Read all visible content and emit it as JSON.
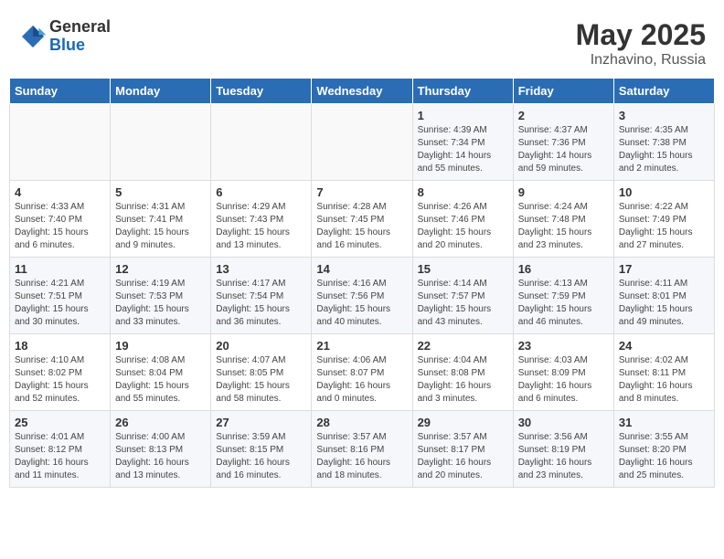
{
  "logo": {
    "general": "General",
    "blue": "Blue"
  },
  "title": "May 2025",
  "location": "Inzhavino, Russia",
  "days_of_week": [
    "Sunday",
    "Monday",
    "Tuesday",
    "Wednesday",
    "Thursday",
    "Friday",
    "Saturday"
  ],
  "weeks": [
    [
      {
        "day": "",
        "info": ""
      },
      {
        "day": "",
        "info": ""
      },
      {
        "day": "",
        "info": ""
      },
      {
        "day": "",
        "info": ""
      },
      {
        "day": "1",
        "info": "Sunrise: 4:39 AM\nSunset: 7:34 PM\nDaylight: 14 hours and 55 minutes."
      },
      {
        "day": "2",
        "info": "Sunrise: 4:37 AM\nSunset: 7:36 PM\nDaylight: 14 hours and 59 minutes."
      },
      {
        "day": "3",
        "info": "Sunrise: 4:35 AM\nSunset: 7:38 PM\nDaylight: 15 hours and 2 minutes."
      }
    ],
    [
      {
        "day": "4",
        "info": "Sunrise: 4:33 AM\nSunset: 7:40 PM\nDaylight: 15 hours and 6 minutes."
      },
      {
        "day": "5",
        "info": "Sunrise: 4:31 AM\nSunset: 7:41 PM\nDaylight: 15 hours and 9 minutes."
      },
      {
        "day": "6",
        "info": "Sunrise: 4:29 AM\nSunset: 7:43 PM\nDaylight: 15 hours and 13 minutes."
      },
      {
        "day": "7",
        "info": "Sunrise: 4:28 AM\nSunset: 7:45 PM\nDaylight: 15 hours and 16 minutes."
      },
      {
        "day": "8",
        "info": "Sunrise: 4:26 AM\nSunset: 7:46 PM\nDaylight: 15 hours and 20 minutes."
      },
      {
        "day": "9",
        "info": "Sunrise: 4:24 AM\nSunset: 7:48 PM\nDaylight: 15 hours and 23 minutes."
      },
      {
        "day": "10",
        "info": "Sunrise: 4:22 AM\nSunset: 7:49 PM\nDaylight: 15 hours and 27 minutes."
      }
    ],
    [
      {
        "day": "11",
        "info": "Sunrise: 4:21 AM\nSunset: 7:51 PM\nDaylight: 15 hours and 30 minutes."
      },
      {
        "day": "12",
        "info": "Sunrise: 4:19 AM\nSunset: 7:53 PM\nDaylight: 15 hours and 33 minutes."
      },
      {
        "day": "13",
        "info": "Sunrise: 4:17 AM\nSunset: 7:54 PM\nDaylight: 15 hours and 36 minutes."
      },
      {
        "day": "14",
        "info": "Sunrise: 4:16 AM\nSunset: 7:56 PM\nDaylight: 15 hours and 40 minutes."
      },
      {
        "day": "15",
        "info": "Sunrise: 4:14 AM\nSunset: 7:57 PM\nDaylight: 15 hours and 43 minutes."
      },
      {
        "day": "16",
        "info": "Sunrise: 4:13 AM\nSunset: 7:59 PM\nDaylight: 15 hours and 46 minutes."
      },
      {
        "day": "17",
        "info": "Sunrise: 4:11 AM\nSunset: 8:01 PM\nDaylight: 15 hours and 49 minutes."
      }
    ],
    [
      {
        "day": "18",
        "info": "Sunrise: 4:10 AM\nSunset: 8:02 PM\nDaylight: 15 hours and 52 minutes."
      },
      {
        "day": "19",
        "info": "Sunrise: 4:08 AM\nSunset: 8:04 PM\nDaylight: 15 hours and 55 minutes."
      },
      {
        "day": "20",
        "info": "Sunrise: 4:07 AM\nSunset: 8:05 PM\nDaylight: 15 hours and 58 minutes."
      },
      {
        "day": "21",
        "info": "Sunrise: 4:06 AM\nSunset: 8:07 PM\nDaylight: 16 hours and 0 minutes."
      },
      {
        "day": "22",
        "info": "Sunrise: 4:04 AM\nSunset: 8:08 PM\nDaylight: 16 hours and 3 minutes."
      },
      {
        "day": "23",
        "info": "Sunrise: 4:03 AM\nSunset: 8:09 PM\nDaylight: 16 hours and 6 minutes."
      },
      {
        "day": "24",
        "info": "Sunrise: 4:02 AM\nSunset: 8:11 PM\nDaylight: 16 hours and 8 minutes."
      }
    ],
    [
      {
        "day": "25",
        "info": "Sunrise: 4:01 AM\nSunset: 8:12 PM\nDaylight: 16 hours and 11 minutes."
      },
      {
        "day": "26",
        "info": "Sunrise: 4:00 AM\nSunset: 8:13 PM\nDaylight: 16 hours and 13 minutes."
      },
      {
        "day": "27",
        "info": "Sunrise: 3:59 AM\nSunset: 8:15 PM\nDaylight: 16 hours and 16 minutes."
      },
      {
        "day": "28",
        "info": "Sunrise: 3:57 AM\nSunset: 8:16 PM\nDaylight: 16 hours and 18 minutes."
      },
      {
        "day": "29",
        "info": "Sunrise: 3:57 AM\nSunset: 8:17 PM\nDaylight: 16 hours and 20 minutes."
      },
      {
        "day": "30",
        "info": "Sunrise: 3:56 AM\nSunset: 8:19 PM\nDaylight: 16 hours and 23 minutes."
      },
      {
        "day": "31",
        "info": "Sunrise: 3:55 AM\nSunset: 8:20 PM\nDaylight: 16 hours and 25 minutes."
      }
    ]
  ]
}
